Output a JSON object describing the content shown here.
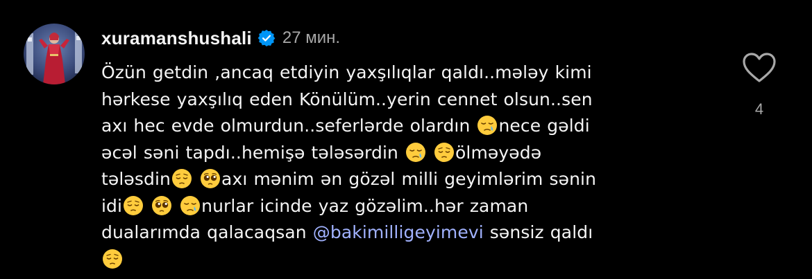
{
  "comment": {
    "username": "xuramanshushali",
    "time": "27 мин.",
    "lines": [
      [
        "Özün getdin ,ancaq etdiyin yaxşılıqlar qaldı..mələy kimi"
      ],
      [
        "hərkese yaxşılıq eden Könülüm..yerin cennet olsun..sen"
      ],
      [
        "axı hec evde olmurdun..seferlərde olardın ",
        "{sleepy}",
        "nece gəldi"
      ],
      [
        "əcəl səni tapdı..hemişə tələsərdin ",
        "{sleepy}",
        " ",
        "{pensive}",
        "ölməyədə"
      ],
      [
        "tələsdin",
        "{pensive}",
        " ",
        "{pleading}",
        "axı mənim ən gözəl milli geyimlərim sənin"
      ],
      [
        "idi",
        "{pensive}",
        " ",
        "{pleading}",
        " ",
        "{sleepy}",
        "nurlar icinde yaz gözəlim..hər zaman"
      ],
      [
        "dualarımda qalacaqsan ",
        "{mention}",
        " sənsiz qaldı"
      ],
      [
        "{pensive}"
      ]
    ],
    "mention": "@bakimilligeyimevi",
    "like_count": "4"
  },
  "icons": {
    "verified": "verified-badge-icon",
    "heart": "heart-outline-icon",
    "emoji_sleepy": "sleepy-face-emoji",
    "emoji_pensive": "pensive-face-emoji",
    "emoji_pleading": "pleading-face-emoji"
  },
  "colors": {
    "background": "#000000",
    "text": "#f5f5f5",
    "muted": "#a8a8a8",
    "mention": "#a1b2ff",
    "verified": "#0095f6"
  }
}
